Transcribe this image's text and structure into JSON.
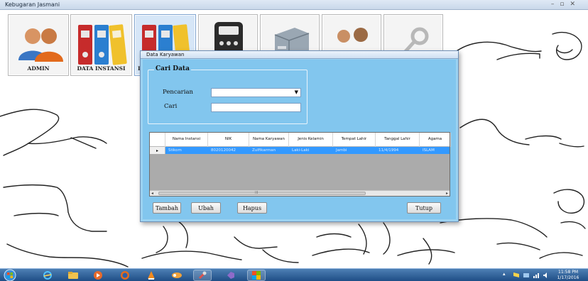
{
  "app": {
    "title": "Kebugaran Jasmani"
  },
  "toolbar": {
    "tiles": [
      {
        "label": "ADMIN",
        "icon": "users-icon"
      },
      {
        "label": "DATA INSTANSI",
        "icon": "binders-icon"
      },
      {
        "label": "D",
        "icon": "binders-icon"
      },
      {
        "label": "",
        "icon": "calculator-icon"
      },
      {
        "label": "",
        "icon": "filing-cabinet-icon"
      },
      {
        "label": "",
        "icon": "people-icon"
      },
      {
        "label": "",
        "icon": "key-icon"
      }
    ]
  },
  "dialog": {
    "title": "Data Karyawan",
    "search": {
      "legend": "Cari Data",
      "pencarian_label": "Pencarian",
      "pencarian_value": "",
      "cari_label": "Cari",
      "cari_value": ""
    },
    "grid": {
      "columns": [
        "Nama Instansi",
        "NIK",
        "Nama Karyawan",
        "Jenis Kelamin",
        "Tempat Lahir",
        "Tanggal Lahir",
        "Agama"
      ],
      "rows": [
        [
          "Stikom",
          "8020120042",
          "Zulfikarman",
          "Laki-Laki",
          "Jambi",
          "11/4/1994",
          "ISLAM"
        ]
      ],
      "row_selector": "▸",
      "scroll_left": "◂",
      "scroll_right": "▸",
      "scroll_mark": "III"
    },
    "buttons": {
      "tambah": "Tambah",
      "ubah": "Ubah",
      "hapus": "Hapus",
      "tutup": "Tutup"
    }
  },
  "taskbar": {
    "clock_time": "11:58 PM",
    "clock_date": "1/17/2016"
  },
  "colors": {
    "dialog_body": "#82c6ee",
    "selected_row": "#3399ff",
    "taskbar": "#1f4e86"
  }
}
